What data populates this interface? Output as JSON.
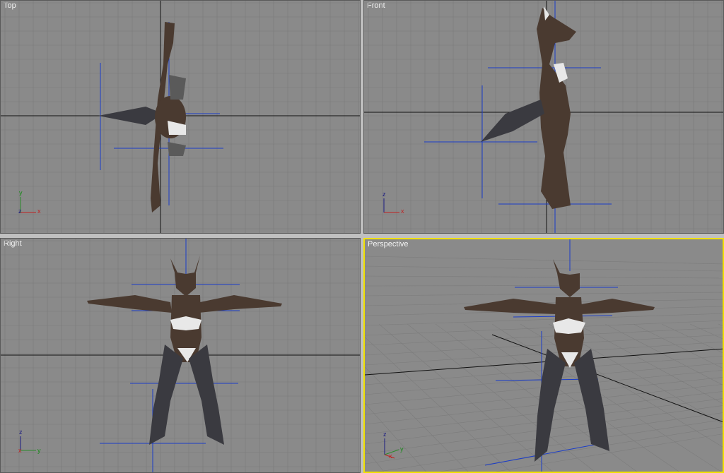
{
  "viewports": [
    {
      "id": "top",
      "label": "Top",
      "axes": [
        "y",
        "z",
        "x"
      ]
    },
    {
      "id": "front",
      "label": "Front",
      "axes": [
        "z",
        "x"
      ]
    },
    {
      "id": "right",
      "label": "Right",
      "axes": [
        "z",
        "x",
        "y"
      ]
    },
    {
      "id": "perspective",
      "label": "Perspective",
      "axes": [
        "z",
        "x",
        "y"
      ],
      "active": true
    }
  ],
  "colors": {
    "viewport_bg": "#8a8a8a",
    "grid": "#7a7a7a",
    "world_axis": "#111111",
    "bone": "#1a3cc8",
    "active_border": "#f0e000",
    "fur": "#4a3a30",
    "underwear": "#e8e8e8"
  }
}
